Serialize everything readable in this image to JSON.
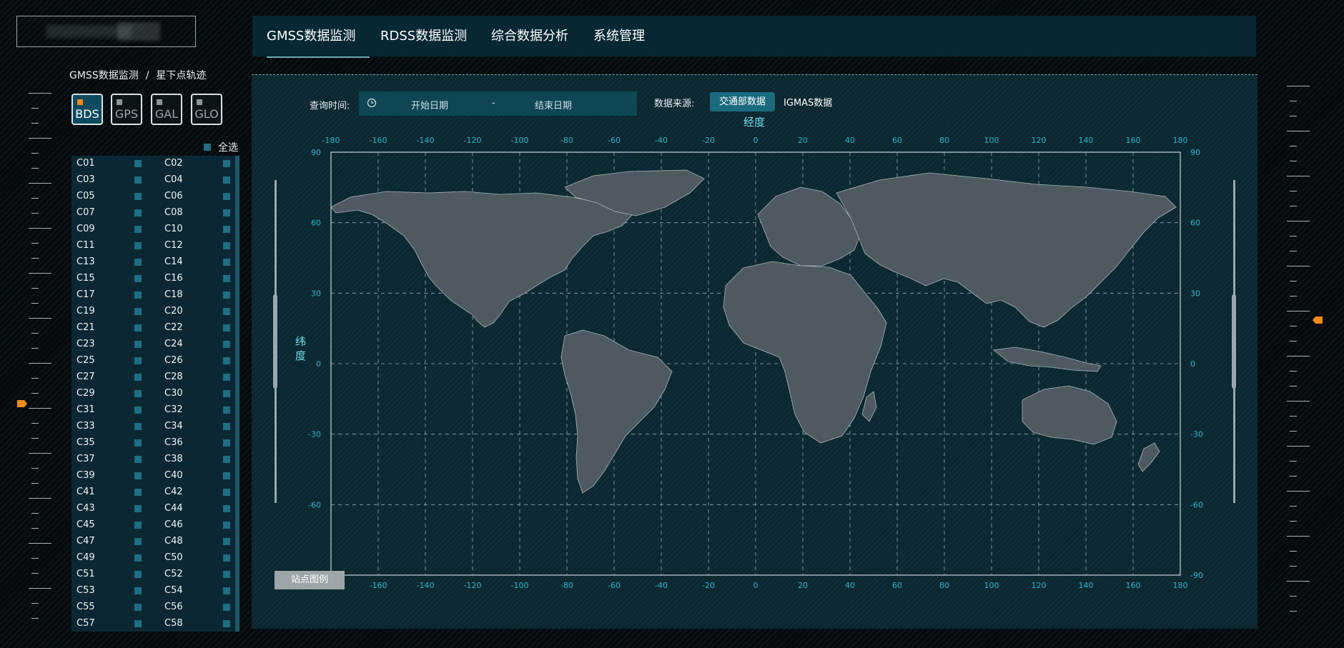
{
  "breadcrumb": {
    "root": "GMSS数据监测",
    "sep": "/",
    "current": "星下点轨迹"
  },
  "systems": [
    {
      "label": "BDS",
      "active": true
    },
    {
      "label": "GPS",
      "active": false
    },
    {
      "label": "GAL",
      "active": false
    },
    {
      "label": "GLO",
      "active": false
    }
  ],
  "select_all_label": "全选",
  "satellites": [
    "C01",
    "C02",
    "C03",
    "C04",
    "C05",
    "C06",
    "C07",
    "C08",
    "C09",
    "C10",
    "C11",
    "C12",
    "C13",
    "C14",
    "C15",
    "C16",
    "C17",
    "C18",
    "C19",
    "C20",
    "C21",
    "C22",
    "C23",
    "C24",
    "C25",
    "C26",
    "C27",
    "C28",
    "C29",
    "C30",
    "C31",
    "C32",
    "C33",
    "C34",
    "C35",
    "C36",
    "C37",
    "C38",
    "C39",
    "C40",
    "C41",
    "C42",
    "C43",
    "C44",
    "C45",
    "C46",
    "C47",
    "C48",
    "C49",
    "C50",
    "C51",
    "C52",
    "C53",
    "C54",
    "C55",
    "C56",
    "C57",
    "C58"
  ],
  "tabs": [
    {
      "label": "GMSS数据监测",
      "active": true
    },
    {
      "label": "RDSS数据监测",
      "active": false
    },
    {
      "label": "综合数据分析",
      "active": false
    },
    {
      "label": "系统管理",
      "active": false
    }
  ],
  "query": {
    "time_label": "查询时间:",
    "start_placeholder": "开始日期",
    "range_sep": "-",
    "end_placeholder": "结束日期",
    "source_label": "数据来源:",
    "source_options": [
      "交通部数据",
      "IGMAS数据"
    ],
    "source_selected": "交通部数据"
  },
  "map": {
    "lng_title": "经度",
    "lat_title": "纬度",
    "lng_ticks": [
      -180,
      -160,
      -140,
      -120,
      -100,
      -80,
      -60,
      -40,
      -20,
      0,
      20,
      40,
      60,
      80,
      100,
      120,
      140,
      160,
      180
    ],
    "lat_ticks": [
      90,
      60,
      30,
      0,
      -30,
      -60,
      -90
    ],
    "bottom_first_label": "180"
  },
  "legend_button": "站点图例",
  "colors": {
    "accent": "#1b6b7f",
    "axis": "#2ab5cc",
    "title": "#6ee0f0",
    "marker": "#f08a1c"
  }
}
